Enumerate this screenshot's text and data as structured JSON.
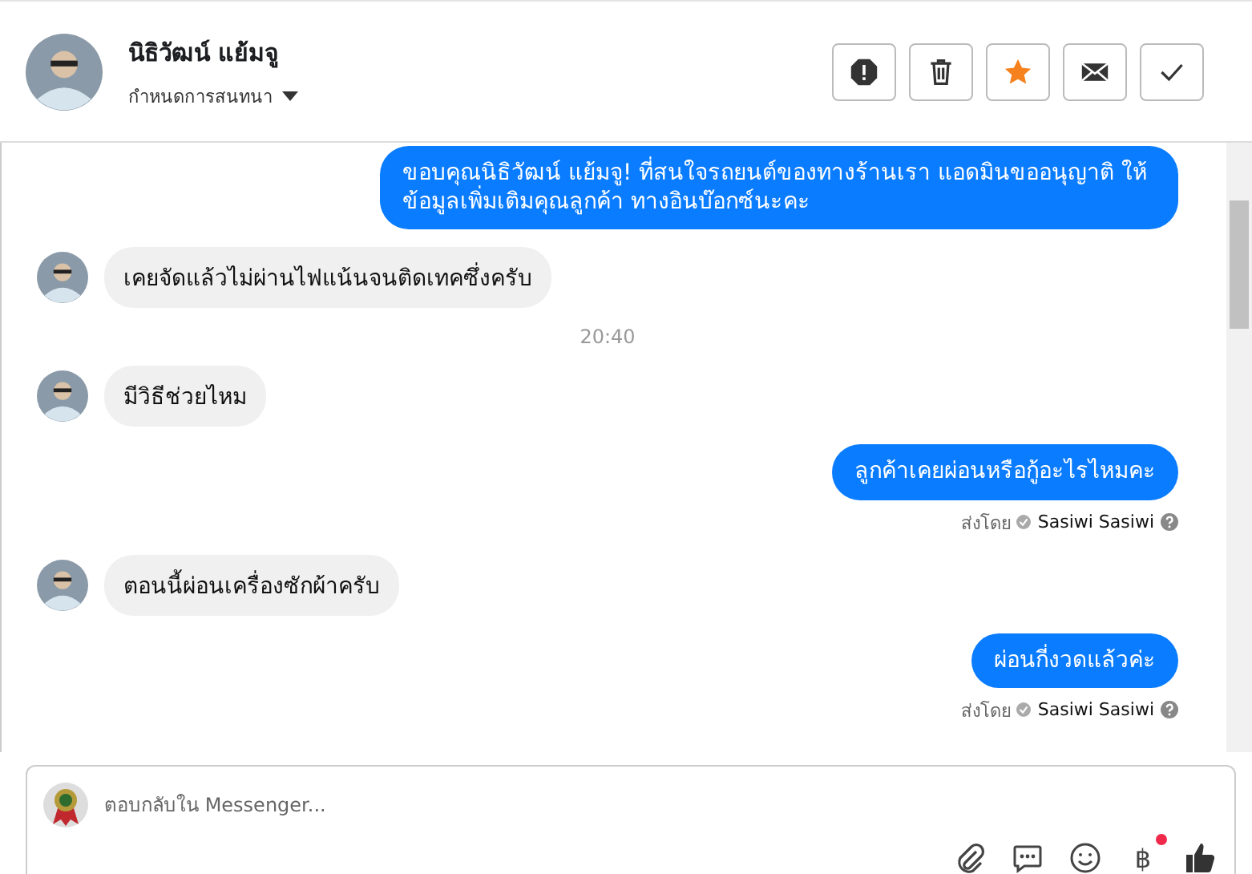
{
  "header": {
    "name": "นิธิวัฒน์ แย้มจู",
    "label_menu": "กำหนดการสนทนา",
    "starred": true,
    "actions": [
      {
        "kind": "alert"
      },
      {
        "kind": "trash"
      },
      {
        "kind": "star"
      },
      {
        "kind": "mail"
      },
      {
        "kind": "check"
      }
    ]
  },
  "messages": [
    {
      "kind": "outgoing",
      "text": "ขอบคุณนิธิวัฒน์ แย้มจู! ที่สนใจรถยนต์ของทางร้านเรา แอดมินขออนุญาติ ให้ข้อมูลเพิ่มเติมคุณลูกค้า ทางอินบ๊อกซ์นะคะ"
    },
    {
      "kind": "incoming",
      "text": "เคยจัดแล้วไม่ผ่านไฟแน้นจนติดเทคซึ่งครับ"
    },
    {
      "kind": "time",
      "text": "20:40"
    },
    {
      "kind": "incoming",
      "text": "มีวิธีช่วยไหม"
    },
    {
      "kind": "outgoing",
      "text": "ลูกค้าเคยผ่อนหรือกู้อะไรไหมคะ",
      "sent_by": "ส่งโดย",
      "sender": "Sasiwi Sasiwi"
    },
    {
      "kind": "incoming",
      "text": "ตอนนี้ผ่อนเครื่องซักผ้าครับ"
    },
    {
      "kind": "outgoing",
      "text": "ผ่อนกี่งวดแล้วค่ะ",
      "sent_by": "ส่งโดย",
      "sender": "Sasiwi Sasiwi"
    }
  ],
  "composer": {
    "placeholder": "ตอบกลับใน Messenger...",
    "tools": [
      {
        "kind": "attach"
      },
      {
        "kind": "saved-reply"
      },
      {
        "kind": "emoji"
      },
      {
        "kind": "baht",
        "text": "฿",
        "badge": true
      },
      {
        "kind": "like"
      }
    ]
  }
}
